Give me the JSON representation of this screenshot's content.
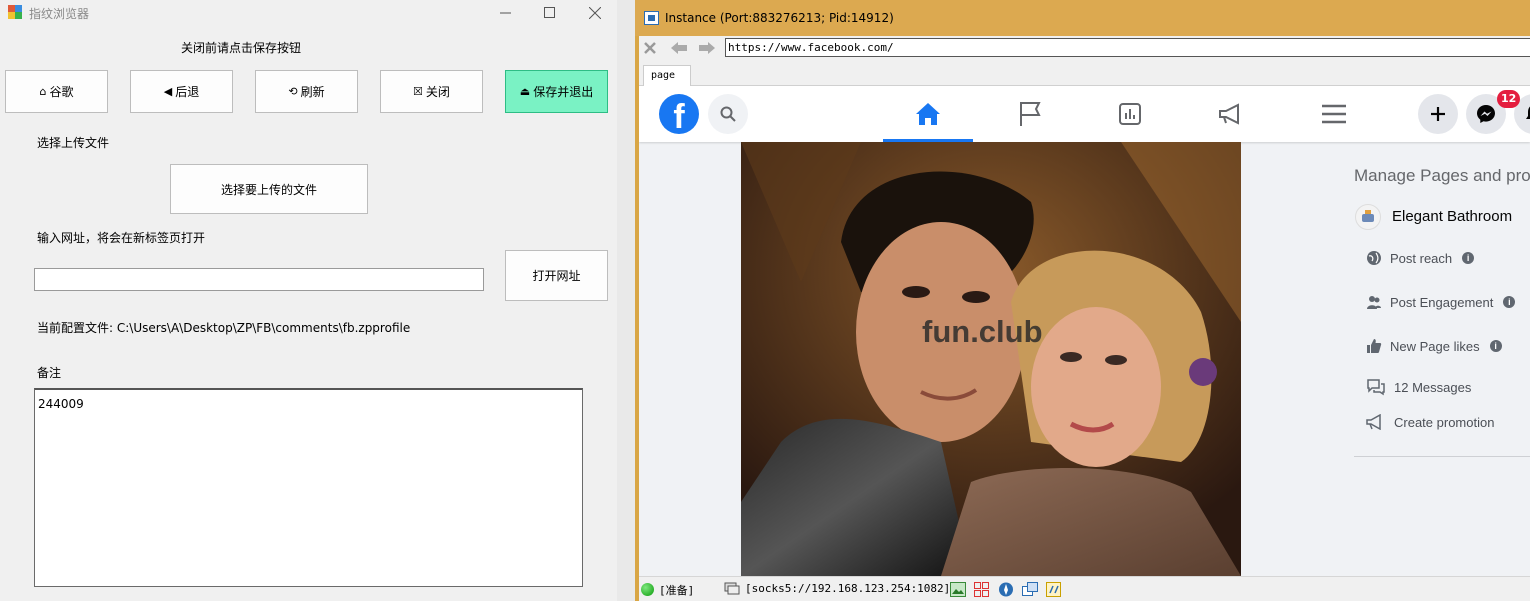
{
  "left_window": {
    "title": "指纹浏览器",
    "notice": "关闭前请点击保存按钮",
    "buttons": {
      "google": "谷歌",
      "back": "后退",
      "refresh": "刷新",
      "close": "关闭",
      "save_exit": "保存并退出"
    },
    "upload_label": "选择上传文件",
    "upload_button": "选择要上传的文件",
    "url_label": "输入网址，将会在新标签页打开",
    "url_value": "",
    "open_url_button": "打开网址",
    "config_file": "当前配置文件: C:\\Users\\A\\Desktop\\ZP\\FB\\comments\\fb.zpprofile",
    "notes_label": "备注",
    "notes_value": "244009"
  },
  "right_window": {
    "title": "Instance (Port:883276213; Pid:14912)",
    "address": "https://www.facebook.com/",
    "tab_label": "page",
    "facebook": {
      "messenger_badge": "12",
      "watermark": "fun.club",
      "manage_title": "Manage Pages and pro",
      "page_name": "Elegant Bathroom",
      "side_items": [
        {
          "label": "Post reach",
          "info": true
        },
        {
          "label": "Post Engagement",
          "info": true
        },
        {
          "label": "New Page likes",
          "info": true
        },
        {
          "label": "12 Messages",
          "info": false
        },
        {
          "label": "Create promotion",
          "info": false
        }
      ]
    },
    "status": {
      "state": "[准备]",
      "proxy": "[socks5://192.168.123.254:1082]"
    }
  },
  "colors": {
    "save_button": "#7af2c4",
    "instance_titlebar": "#dca950",
    "facebook_blue": "#1877f2",
    "badge_red": "#e41e3f"
  }
}
